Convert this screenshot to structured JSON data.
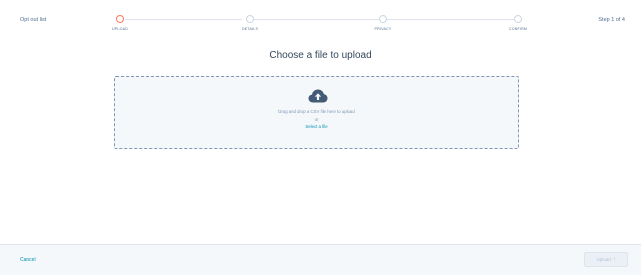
{
  "header": {
    "back_label": "Opt out list",
    "step_indicator": "Step 1 of 4"
  },
  "stepper": {
    "steps": [
      {
        "label": "UPLOAD",
        "state": "active"
      },
      {
        "label": "DETAILS",
        "state": "pending"
      },
      {
        "label": "PRIVACY",
        "state": "pending"
      },
      {
        "label": "CONFIRM",
        "state": "pending"
      }
    ],
    "active_color": "#ff7a59",
    "pending_color": "#cbd6e2"
  },
  "main": {
    "title": "Choose a file to upload",
    "dropzone": {
      "icon": "cloud-upload-icon",
      "instruction": "Drag and drop a CSV file here to upload",
      "or_text": "or",
      "select_label": "Select a file"
    }
  },
  "footer": {
    "cancel_label": "Cancel",
    "next_label": "Upload",
    "next_icon": "chevron-right-icon"
  },
  "colors": {
    "link": "#0091ae",
    "accent": "#ff7a59",
    "text": "#33475b"
  }
}
